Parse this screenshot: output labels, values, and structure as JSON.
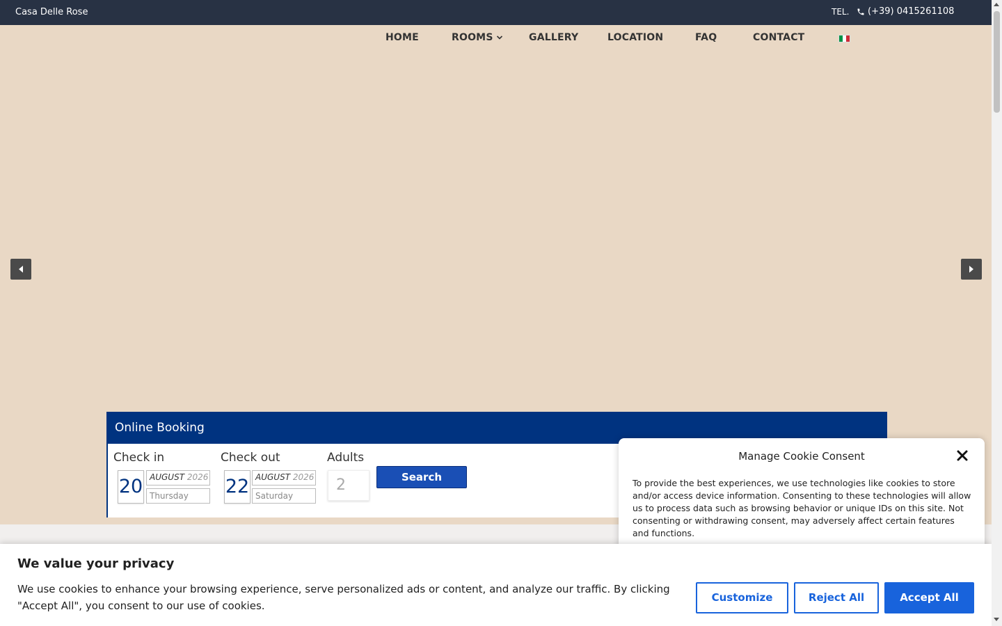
{
  "topbar": {
    "brand": "Casa Delle Rose",
    "tel_label": "TEL.",
    "phone": "(+39) 0415261108"
  },
  "nav": {
    "items": [
      {
        "label": "HOME"
      },
      {
        "label": "ROOMS"
      },
      {
        "label": "GALLERY"
      },
      {
        "label": "LOCATION"
      },
      {
        "label": "FAQ"
      },
      {
        "label": "CONTACT"
      }
    ],
    "flag_colors": [
      "#009246",
      "#ffffff",
      "#ce2b37"
    ]
  },
  "slider": {
    "prev_icon": "triangle-left-icon",
    "next_icon": "triangle-right-icon"
  },
  "booking": {
    "title": "Online Booking",
    "checkin": {
      "label": "Check in",
      "day": "20",
      "month": "AUGUST",
      "year": "2026",
      "weekday": "Thursday"
    },
    "checkout": {
      "label": "Check out",
      "day": "22",
      "month": "AUGUST",
      "year": "2026",
      "weekday": "Saturday"
    },
    "adults": {
      "label": "Adults",
      "value": "2"
    },
    "search_label": "Search"
  },
  "consent": {
    "title": "Manage Cookie Consent",
    "text": "To provide the best experiences, we use technologies like cookies to store and/or access device information. Consenting to these technologies will allow us to process data such as browsing behavior or unique IDs on this site. Not consenting or withdrawing consent, may adversely affect certain features and functions."
  },
  "privacy": {
    "title": "We value your privacy",
    "text": "We use cookies to enhance your browsing experience, serve personalized ads or content, and analyze our traffic. By clicking \"Accept All\", you consent to our use of cookies.",
    "customize_label": "Customize",
    "reject_label": "Reject All",
    "accept_label": "Accept All"
  },
  "colors": {
    "topbar": "#283244",
    "hero_bg": "#e9d8c5",
    "booking_blue": "#003380",
    "button_blue": "#1863dc"
  }
}
